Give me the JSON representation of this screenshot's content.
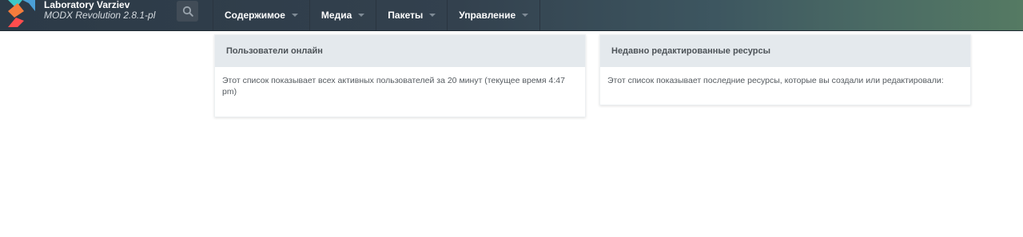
{
  "header": {
    "site_name": "Laboratory Varziev",
    "site_version": "MODX Revolution 2.8.1-pl",
    "search_icon": "search-icon",
    "nav": [
      {
        "label": "Содержимое"
      },
      {
        "label": "Медиа"
      },
      {
        "label": "Пакеты"
      },
      {
        "label": "Управление"
      }
    ]
  },
  "widgets": {
    "online_users": {
      "title": "Пользователи онлайн",
      "text": "Этот список показывает всех активных пользователей за 20 минут (текущее время 4:47 pm)"
    },
    "recent_resources": {
      "title": "Недавно редактированные ресурсы",
      "text": "Этот список показывает последние ресурсы, которые вы создали или редактировали:"
    }
  },
  "colors": {
    "brand_cyan": "#3dc8c8",
    "brand_orange": "#f47c3c",
    "brand_red": "#ff4d4d",
    "brand_blue": "#4a9fd6"
  }
}
